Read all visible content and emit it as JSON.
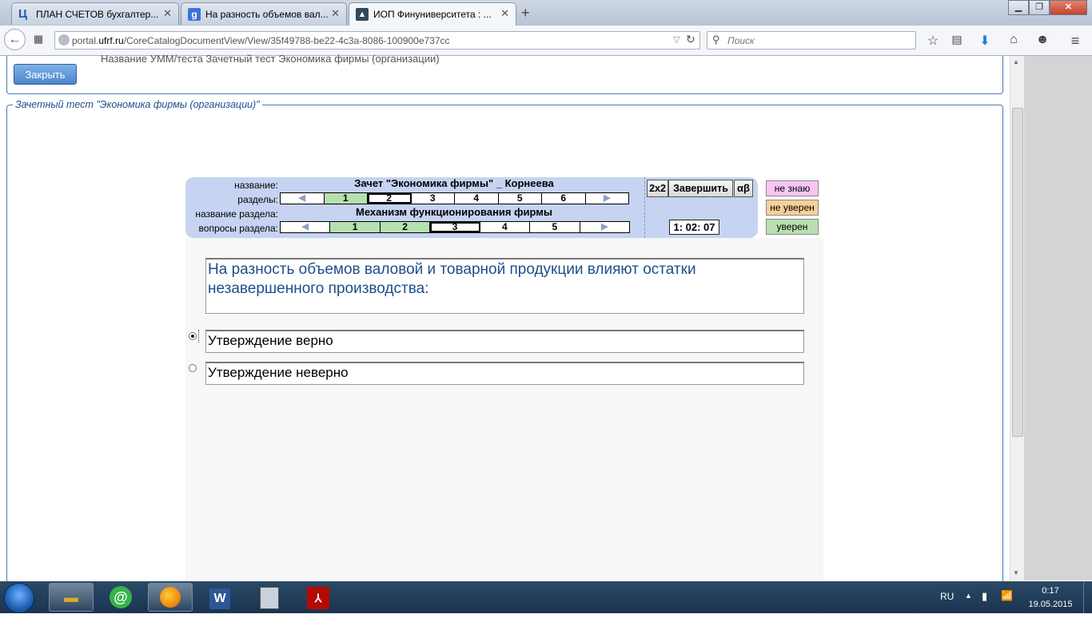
{
  "browser": {
    "tabs": [
      {
        "title": "ПЛАН СЧЕТОВ бухгалтер...",
        "icon": "ts-logo-icon",
        "active": false
      },
      {
        "title": "На разность объемов вал...",
        "icon": "google-icon",
        "active": false
      },
      {
        "title": "ИОП Финуниверситета : ...",
        "icon": "mortarboard-icon",
        "active": true
      }
    ],
    "url_prefix": "portal.",
    "url_domain": "ufrf.ru",
    "url_path": "/CoreCatalogDocumentView/View/35f49788-be22-4c3a-8086-100900e737cc",
    "search_placeholder": "Поиск"
  },
  "page": {
    "close_button": "Закрыть",
    "umm_line": "Название УММ/теста  Зачетный тест  Экономика фирмы (организации)",
    "legend": "Зачетный тест \"Экономика фирмы (организации)\""
  },
  "test": {
    "name_label": "название:",
    "name_value": "Зачет \"Экономика фирмы\" _ Корнеева",
    "sections_label": "разделы:",
    "sections": [
      "1",
      "2",
      "3",
      "4",
      "5",
      "6"
    ],
    "sections_answered": [
      1
    ],
    "sections_current": 2,
    "section_name_label": "название раздела:",
    "section_name_value": "Механизм функционирования  фирмы",
    "questions_label": "вопросы раздела:",
    "questions": [
      "1",
      "2",
      "3",
      "4",
      "5"
    ],
    "questions_answered": [
      1,
      2
    ],
    "questions_current": 3,
    "btn_2x2": "2x2",
    "btn_finish": "Завершить",
    "btn_ab": "αβ",
    "timer": "1: 02: 07",
    "confidence": {
      "dont_know": "не знаю",
      "not_sure": "не уверен",
      "sure": "уверен"
    },
    "confidence_colors": {
      "dont_know": "#f7c6f2",
      "not_sure": "#f8cf9a",
      "sure": "#b9e0b0"
    },
    "question": "На разность объемов валовой и товарной продукции влияют остатки незавершенного производства:",
    "answers": [
      "Утверждение верно",
      "Утверждение  неверно"
    ],
    "selected_answer": 1
  },
  "taskbar": {
    "lang": "RU",
    "time": "0:17",
    "date": "19.05.2015"
  }
}
